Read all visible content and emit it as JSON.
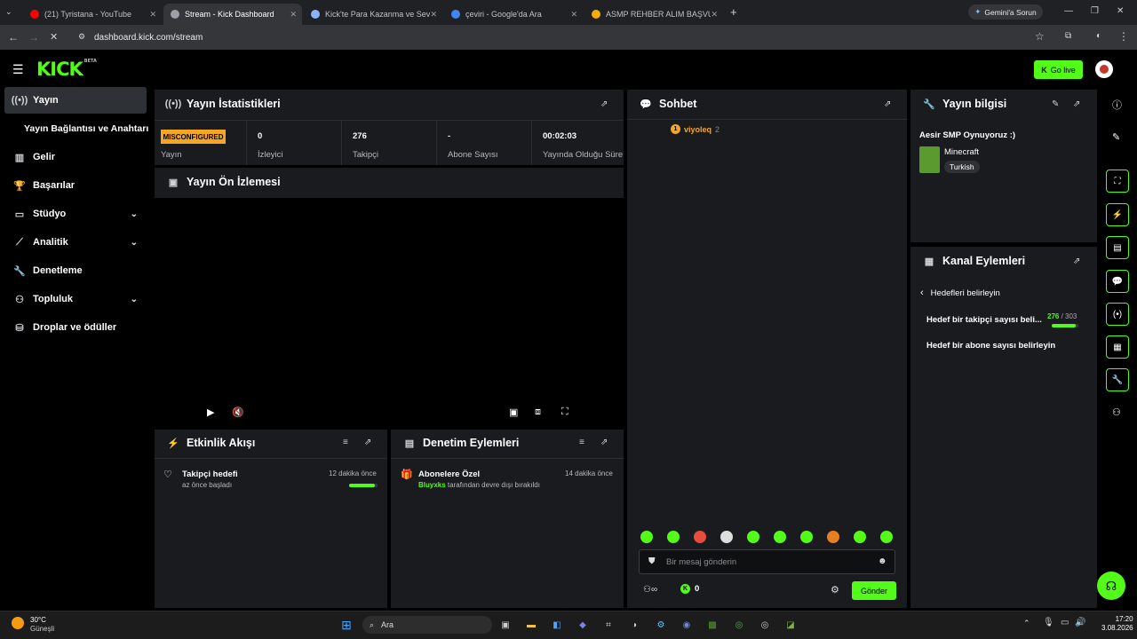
{
  "browser": {
    "tabs": [
      {
        "title": "(21) Tyristana - YouTube",
        "favicon_color": "#ff0000",
        "active": false
      },
      {
        "title": "Stream - Kick Dashboard",
        "favicon_color": "#9aa0a6",
        "active": true
      },
      {
        "title": "Kick'te Para Kazanma ve Seviye",
        "favicon_color": "#8ab4f8",
        "active": false
      },
      {
        "title": "çeviri - Google'da Ara",
        "favicon_color": "#4285f4",
        "active": false
      },
      {
        "title": "ASMP REHBER ALIM BAŞVURU",
        "favicon_color": "#f9ab00",
        "active": false
      }
    ],
    "gemini_button": "Gemini'a Sorun",
    "url": "dashboard.kick.com/stream"
  },
  "app": {
    "logo": "KICK",
    "logo_sup": "BETA",
    "go_live": "Go live",
    "brand_color": "#53fc18"
  },
  "sidebar": {
    "items": [
      {
        "label": "Yayın",
        "icon": "stream-icon",
        "selected": true
      },
      {
        "label": "Yayın Bağlantısı ve Anahtarı",
        "icon": "",
        "selected": false
      },
      {
        "label": "Gelir",
        "icon": "chart-icon",
        "selected": false
      },
      {
        "label": "Başarılar",
        "icon": "trophy-icon",
        "selected": false
      },
      {
        "label": "Stüdyo",
        "icon": "studio-icon",
        "selected": false,
        "expandable": true
      },
      {
        "label": "Analitik",
        "icon": "analytics-icon",
        "selected": false,
        "expandable": true
      },
      {
        "label": "Denetleme",
        "icon": "wrench-icon",
        "selected": false
      },
      {
        "label": "Topluluk",
        "icon": "community-icon",
        "selected": false,
        "expandable": true
      },
      {
        "label": "Droplar ve ödüller",
        "icon": "drops-icon",
        "selected": false
      }
    ]
  },
  "stats": {
    "title": "Yayın İstatistikleri",
    "badge": "MISCONFIGURED",
    "items": [
      {
        "value": "",
        "label": "Yayın"
      },
      {
        "value": "0",
        "label": "İzleyici"
      },
      {
        "value": "276",
        "label": "Takipçi"
      },
      {
        "value": "-",
        "label": "Abone Sayısı"
      },
      {
        "value": "00:02:03",
        "label": "Yayında Olduğu Süre"
      }
    ]
  },
  "preview": {
    "title": "Yayın Ön İzlemesi"
  },
  "activity": {
    "title": "Etkinlik Akışı",
    "events": [
      {
        "title": "Takipçi hedefi",
        "sub": "az önce başladı",
        "time": "12 dakika önce",
        "progress": 0.91
      }
    ]
  },
  "moderation": {
    "title": "Denetim Eylemleri",
    "events": [
      {
        "title": "Abonelere Özel",
        "user": "Bluyxks",
        "sub": "tarafından devre dışı bırakıldı",
        "time": "14 dakika önce"
      }
    ]
  },
  "chat": {
    "title": "Sohbet",
    "viewers": [
      {
        "badge": "1",
        "name": "viyoleq",
        "count": "2"
      }
    ],
    "input_placeholder": "Bir mesaj gönderin",
    "points": "0",
    "send": "Gönder"
  },
  "stream_info": {
    "title": "Yayın bilgisi",
    "stream_title": "Aesir SMP Oynuyoruz :)",
    "category": "Minecraft",
    "language": "Turkish"
  },
  "channel_actions": {
    "title": "Kanal Eylemleri",
    "back_label": "Hedefleri belirleyin",
    "goals": [
      {
        "label": "Hedef bir takipçi sayısı beli...",
        "current": "276",
        "target": "303",
        "progress": 0.91
      },
      {
        "label": "Hedef bir abone sayısı belirleyin"
      }
    ]
  },
  "taskbar": {
    "weather_temp": "30°C",
    "weather_desc": "Güneşli",
    "search": "Ara",
    "time": "17:20",
    "date": "3.08.2026"
  }
}
